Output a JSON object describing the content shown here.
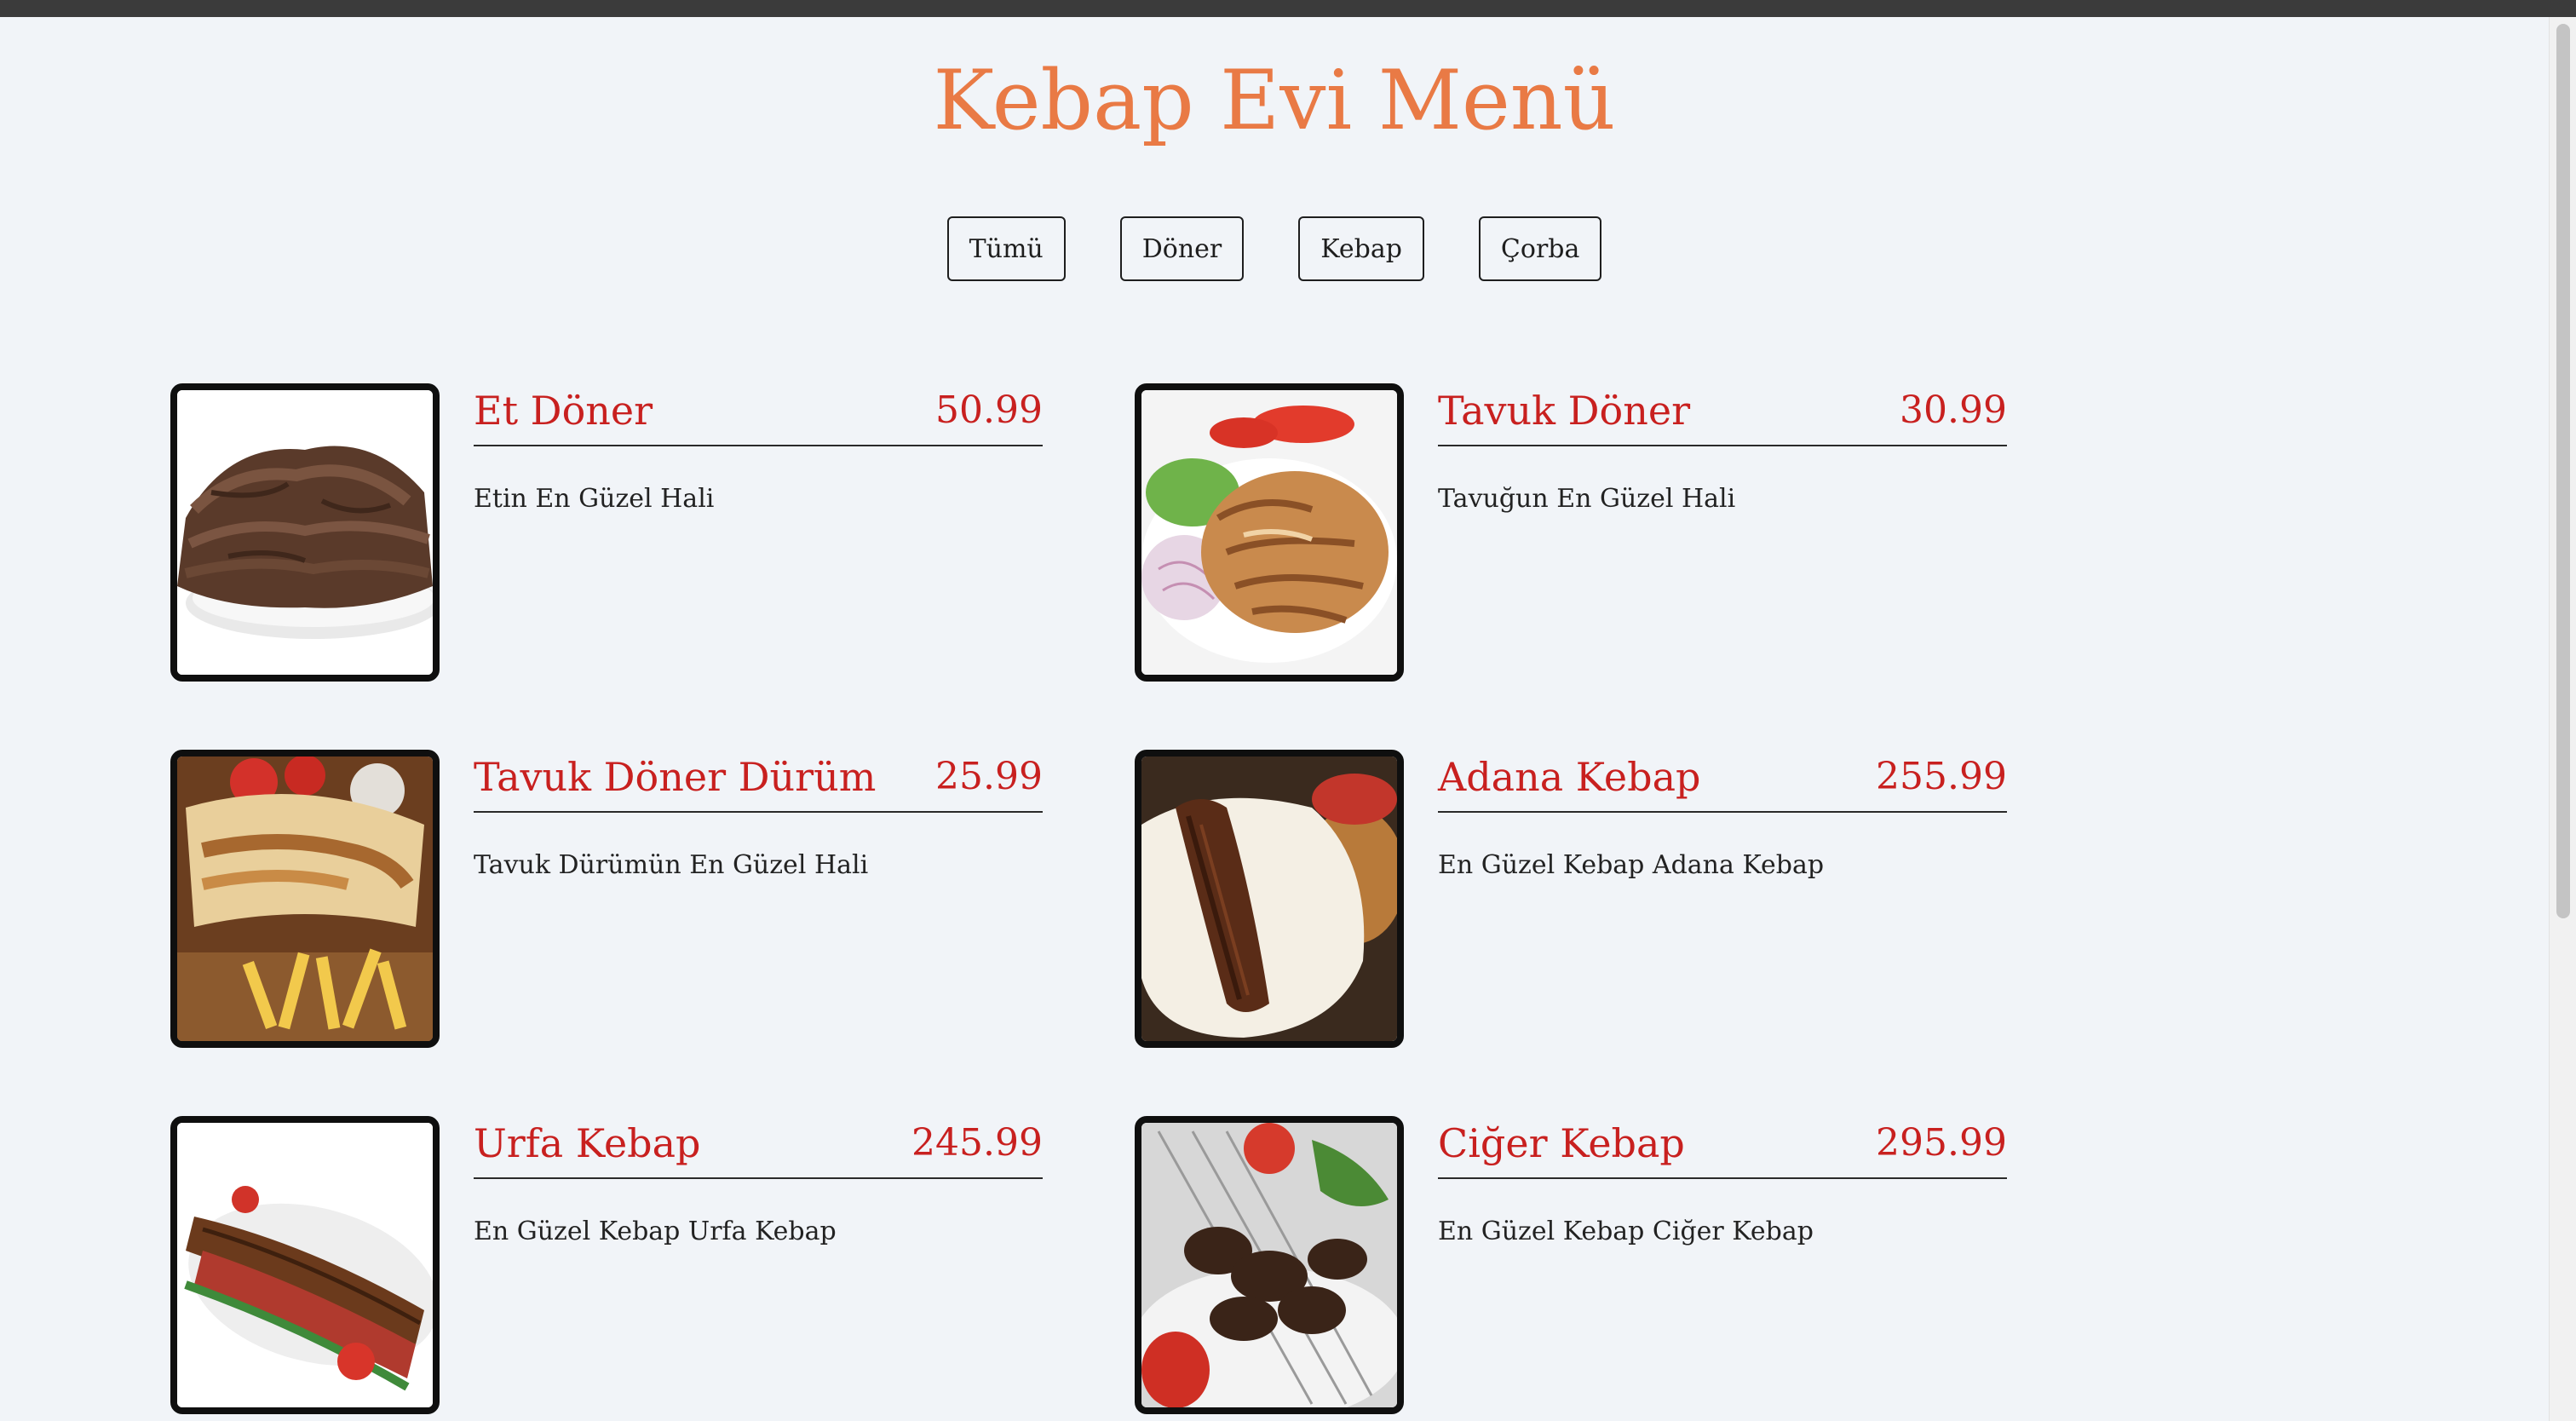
{
  "page": {
    "title": "Kebap Evi Menü"
  },
  "filters": [
    {
      "label": "Tümü"
    },
    {
      "label": "Döner"
    },
    {
      "label": "Kebap"
    },
    {
      "label": "Çorba"
    }
  ],
  "items": [
    {
      "name": "Et Döner",
      "price": "50.99",
      "description": "Etin En Güzel Hali",
      "image": "beef-doner-plate-image"
    },
    {
      "name": "Tavuk Döner",
      "price": "30.99",
      "description": "Tavuğun En Güzel Hali",
      "image": "chicken-doner-plate-image"
    },
    {
      "name": "Tavuk Döner Dürüm",
      "price": "25.99",
      "description": "Tavuk Dürümün En Güzel Hali",
      "image": "chicken-wrap-image"
    },
    {
      "name": "Adana Kebap",
      "price": "255.99",
      "description": "En Güzel Kebap Adana Kebap",
      "image": "adana-kebab-image"
    },
    {
      "name": "Urfa Kebap",
      "price": "245.99",
      "description": "En Güzel Kebap Urfa Kebap",
      "image": "urfa-kebab-image"
    },
    {
      "name": "Ciğer Kebap",
      "price": "295.99",
      "description": "En Güzel Kebap Ciğer Kebap",
      "image": "liver-kebab-image"
    }
  ],
  "colors": {
    "title": "#e97a45",
    "item_text": "#c8201f",
    "background": "#f1f4f8"
  }
}
